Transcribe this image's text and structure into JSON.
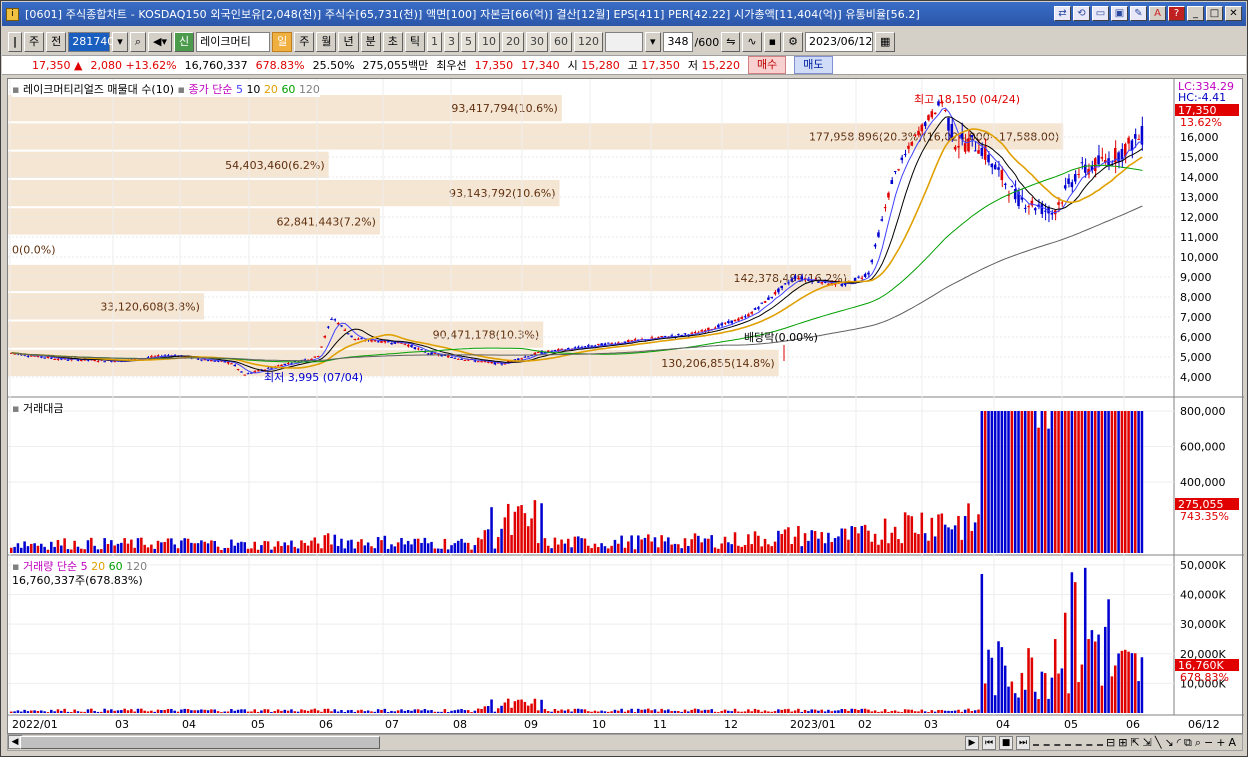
{
  "window": {
    "title": "[0601] 주식종합차트 - KOSDAQ150 외국인보유[2,048(천)] 주식수[65,731(천)] 액면[100] 자본금[66(억)] 결산[12월] EPS[411] PER[42.22] 시가총액[11,404(억)] 유통비율[56.2]"
  },
  "toolbar": {
    "type_label": "주",
    "prev_label": "전",
    "code": "281740",
    "name_badge": "신",
    "name": "레이크머티",
    "periods": [
      "일",
      "주",
      "월",
      "년",
      "분",
      "초",
      "틱"
    ],
    "minutes": [
      "1",
      "3",
      "5",
      "10",
      "20",
      "30",
      "60",
      "120"
    ],
    "count": "348",
    "count_max": "/600",
    "date": "2023/06/12"
  },
  "quote": {
    "price": "17,350",
    "arrow": "▲",
    "change": "2,080",
    "change_pct": "+13.62%",
    "volume": "16,760,337",
    "vol_ratio": "678.83%",
    "turnover": "25.50%",
    "amount": "275,055백만",
    "best_label": "최우선",
    "best_ask": "17,350",
    "best_bid": "17,340",
    "open_label": "시",
    "open": "15,280",
    "high_label": "고",
    "high": "17,350",
    "low_label": "저",
    "low": "15,220",
    "buy": "매수",
    "sell": "매도"
  },
  "price_panel": {
    "legend_name": "레이크머티리얼즈 매물대 수(10)",
    "legend_ma": "종가 단순",
    "ma_periods": [
      "5",
      "10",
      "20",
      "60",
      "120"
    ],
    "lc": "LC:334.29",
    "hc": "HC:-4.41",
    "last_price_tag": "17,350",
    "last_pct_tag": "13.62%",
    "high_note": "최고 18,150 (04/24)",
    "low_note": "최저 3,995 (07/04)",
    "dividend_note": "배당락(0.00%)",
    "y_ticks": [
      "16,000",
      "15,000",
      "14,000",
      "13,000",
      "12,000",
      "11,000",
      "10,000",
      "9,000",
      "8,000",
      "7,000",
      "6,000",
      "5,000",
      "4,000"
    ],
    "volume_profile": [
      {
        "label": "93,417,794(10.6%)",
        "len": 0.475
      },
      {
        "label": "177,958,896(20.3%)(16,024,000~17,588.00)",
        "len": 0.905
      },
      {
        "label": "54,403,460(6.2%)",
        "len": 0.275
      },
      {
        "label": "93,143,792(10.6%)",
        "len": 0.473
      },
      {
        "label": "62,841,443(7.2%)",
        "len": 0.319
      },
      {
        "label": "0(0.0%)",
        "len": 0.0
      },
      {
        "label": "142,378,499(16.2%)",
        "len": 0.723
      },
      {
        "label": "33,120,608(3.8%)",
        "len": 0.168
      },
      {
        "label": "90,471,178(10.3%)",
        "len": 0.459
      },
      {
        "label": "130,206,855(14.8%)",
        "len": 0.661
      }
    ]
  },
  "amount_panel": {
    "legend": "거래대금",
    "y_ticks": [
      "800,000",
      "600,000",
      "400,000"
    ],
    "last_tag": "275,055",
    "last_pct": "743.35%"
  },
  "volume_panel": {
    "legend": "거래량",
    "legend_ma": "단순",
    "ma_periods": [
      "5",
      "20",
      "60",
      "120"
    ],
    "summary": "16,760,337주(678.83%)",
    "y_ticks": [
      "50,000K",
      "40,000K",
      "30,000K",
      "20,000K",
      "10,000K"
    ],
    "last_tag": "16,760K",
    "last_pct": "678.83%"
  },
  "x_axis": [
    "2022/01",
    "03",
    "04",
    "05",
    "06",
    "07",
    "08",
    "09",
    "10",
    "11",
    "12",
    "2023/01",
    "02",
    "03",
    "04",
    "05",
    "06",
    "06/12"
  ],
  "colors": {
    "up": "#e00000",
    "down": "#0000d0",
    "ma5": "#4040ff",
    "ma10": "#000000",
    "ma20": "#e0a000",
    "ma60": "#00a000",
    "ma120": "#606060",
    "profile": "#f5e6d3"
  }
}
